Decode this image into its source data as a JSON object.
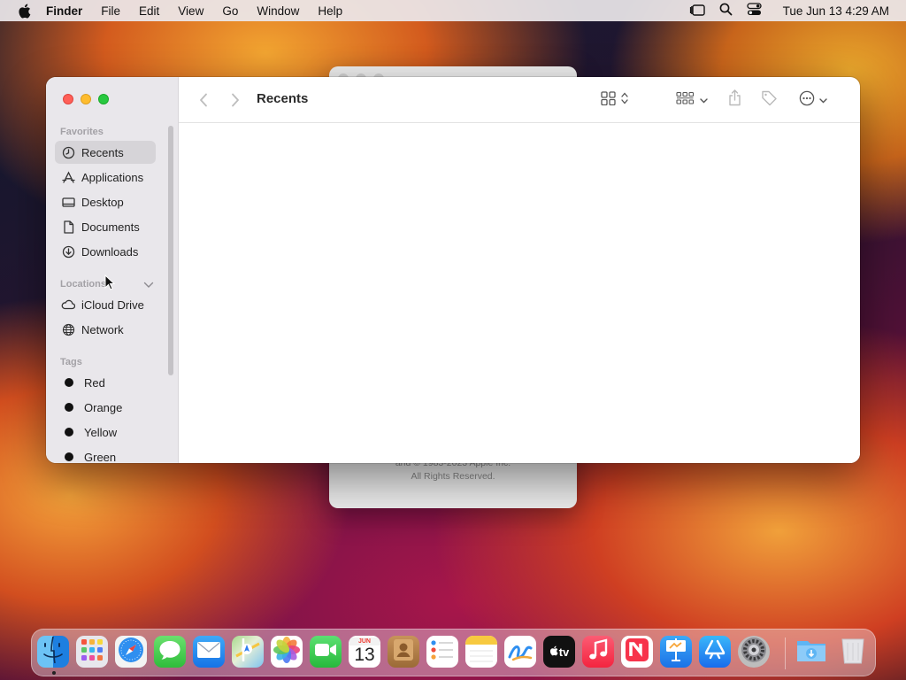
{
  "menubar": {
    "items": [
      "Finder",
      "File",
      "Edit",
      "View",
      "Go",
      "Window",
      "Help"
    ],
    "clock": "Tue Jun 13  4:29 AM"
  },
  "about_window": {
    "copyright_line1": "and © 1983-2023 Apple Inc.",
    "copyright_line2": "All Rights Reserved."
  },
  "finder": {
    "title": "Recents",
    "sidebar": {
      "favorites_label": "Favorites",
      "favorites": [
        {
          "label": "Recents",
          "icon": "clock-icon",
          "selected": true
        },
        {
          "label": "Applications",
          "icon": "applications-icon"
        },
        {
          "label": "Desktop",
          "icon": "desktop-icon"
        },
        {
          "label": "Documents",
          "icon": "document-icon"
        },
        {
          "label": "Downloads",
          "icon": "download-icon"
        }
      ],
      "locations_label": "Locations",
      "locations": [
        {
          "label": "iCloud Drive",
          "icon": "cloud-icon"
        },
        {
          "label": "Network",
          "icon": "globe-icon"
        }
      ],
      "tags_label": "Tags",
      "tags": [
        {
          "label": "Red",
          "color": "#111111"
        },
        {
          "label": "Orange",
          "color": "#111111"
        },
        {
          "label": "Yellow",
          "color": "#111111"
        },
        {
          "label": "Green",
          "color": "#111111"
        }
      ]
    }
  },
  "dock": {
    "calendar_month": "JUN",
    "calendar_day": "13",
    "tv_label": "tv",
    "apps": [
      "Finder",
      "Launchpad",
      "Safari",
      "Messages",
      "Mail",
      "Maps",
      "Photos",
      "FaceTime",
      "Calendar",
      "Contacts",
      "Reminders",
      "Notes",
      "Freeform",
      "TV",
      "Music",
      "News",
      "Keynote",
      "App Store",
      "System Settings",
      "Downloads",
      "Trash"
    ]
  }
}
